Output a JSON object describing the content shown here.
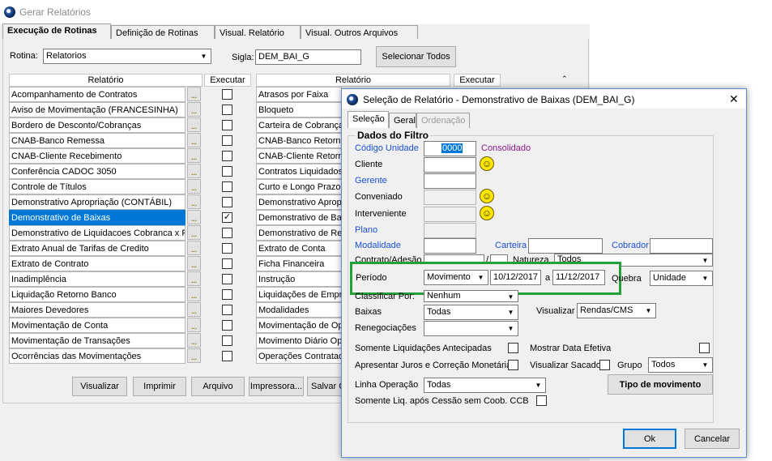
{
  "window": {
    "title": "Gerar Relatórios"
  },
  "tabs": [
    "Execução de Rotinas",
    "Definição de Rotinas",
    "Visual. Relatório",
    "Visual. Outros Arquivos"
  ],
  "rotina": {
    "label": "Rotina:",
    "value": "Relatorios"
  },
  "sigla": {
    "label": "Sigla:",
    "value": "DEM_BAI_G"
  },
  "select_all": "Selecionar Todos",
  "table": {
    "col_relatorio": "Relatório",
    "col_executar": "Executar",
    "left": [
      {
        "name": "Acompanhamento de Contratos",
        "checked": false
      },
      {
        "name": "Aviso de Movimentação (FRANCESINHA)",
        "checked": false
      },
      {
        "name": "Bordero de Desconto/Cobranças",
        "checked": false
      },
      {
        "name": "CNAB-Banco Remessa",
        "checked": false
      },
      {
        "name": "CNAB-Cliente Recebimento",
        "checked": false
      },
      {
        "name": "Conferência CADOC 3050",
        "checked": false
      },
      {
        "name": "Controle de Títulos",
        "checked": false
      },
      {
        "name": "Demonstrativo Apropriação (CONTÁBIL)",
        "checked": false
      },
      {
        "name": "Demonstrativo de Baixas",
        "checked": true,
        "selected": true
      },
      {
        "name": "Demonstrativo de Liquidacoes Cobranca x Re",
        "checked": false
      },
      {
        "name": "Extrato Anual de Tarifas de Credito",
        "checked": false
      },
      {
        "name": "Extrato de Contrato",
        "checked": false
      },
      {
        "name": "Inadimplência",
        "checked": false
      },
      {
        "name": "Liquidação Retorno Banco",
        "checked": false
      },
      {
        "name": "Maiores Devedores",
        "checked": false
      },
      {
        "name": "Movimentação de Conta",
        "checked": false
      },
      {
        "name": "Movimentação de Transações",
        "checked": false
      },
      {
        "name": "Ocorrências das Movimentações",
        "checked": false
      }
    ],
    "right": [
      {
        "name": "Atrasos por Faixa"
      },
      {
        "name": "Bloqueto"
      },
      {
        "name": "Carteira de Cobrança"
      },
      {
        "name": "CNAB-Banco Retorno"
      },
      {
        "name": "CNAB-Cliente Retorno"
      },
      {
        "name": "Contratos Liquidados"
      },
      {
        "name": "Curto e Longo Prazo"
      },
      {
        "name": "Demonstrativo Apropr"
      },
      {
        "name": "Demonstrativo de Bai"
      },
      {
        "name": "Demonstrativo de Ren"
      },
      {
        "name": "Extrato de Conta"
      },
      {
        "name": "Ficha Financeira"
      },
      {
        "name": "Instrução"
      },
      {
        "name": "Liquidações de Empre"
      },
      {
        "name": "Modalidades"
      },
      {
        "name": "Movimentação de Op"
      },
      {
        "name": "Movimento Diário Ope"
      },
      {
        "name": "Operações Contratad"
      }
    ]
  },
  "bottom_buttons": [
    "Visualizar",
    "Imprimir",
    "Arquivo",
    "Impressora...",
    "Salvar C"
  ],
  "dialog": {
    "title": "Seleção de Relatório - Demonstrativo de Baixas (DEM_BAI_G)",
    "tabs": [
      "Seleção",
      "Geral",
      "Ordenação"
    ],
    "group_title": "Dados do Filtro",
    "codigo_unidade": {
      "label": "Código Unidade",
      "value": "0000"
    },
    "consolidado": "Consolidado",
    "cliente": "Cliente",
    "gerente": "Gerente",
    "conveniado": "Conveniado",
    "interveniente": "Interveniente",
    "plano": "Plano",
    "modalidade": "Modalidade",
    "carteira": "Carteira",
    "cobrador": "Cobrador",
    "contrato_adesao": "Contrato/Adesão",
    "slash": "/",
    "natureza": {
      "label": "Natureza",
      "value": "Todos"
    },
    "periodo": {
      "label": "Período",
      "type": "Movimento",
      "from": "10/12/2017",
      "a": "a",
      "to": "11/12/2017"
    },
    "quebra": {
      "label": "Quebra",
      "value": "Unidade"
    },
    "classificar": {
      "label": "Classificar Por:",
      "value": "Nenhum"
    },
    "baixas": {
      "label": "Baixas",
      "value": "Todas"
    },
    "visualizar": {
      "label": "Visualizar",
      "value": "Rendas/CMS"
    },
    "renegociacoes": {
      "label": "Renegociações",
      "value": ""
    },
    "somente_liq": "Somente Liquidações Antecipadas",
    "mostrar_data": "Mostrar Data Efetiva",
    "apresentar_juros": "Apresentar Juros e Correção Monetária",
    "visualizar_sacado": "Visualizar Sacado",
    "grupo": {
      "label": "Grupo",
      "value": "Todos"
    },
    "linha_operacao": {
      "label": "Linha Operação",
      "value": "Todas"
    },
    "tipo_movimento": "Tipo de movimento",
    "somente_cessao": "Somente Liq. após Cessão sem Coob. CCB",
    "ok": "Ok",
    "cancelar": "Cancelar",
    "close": "✕"
  }
}
